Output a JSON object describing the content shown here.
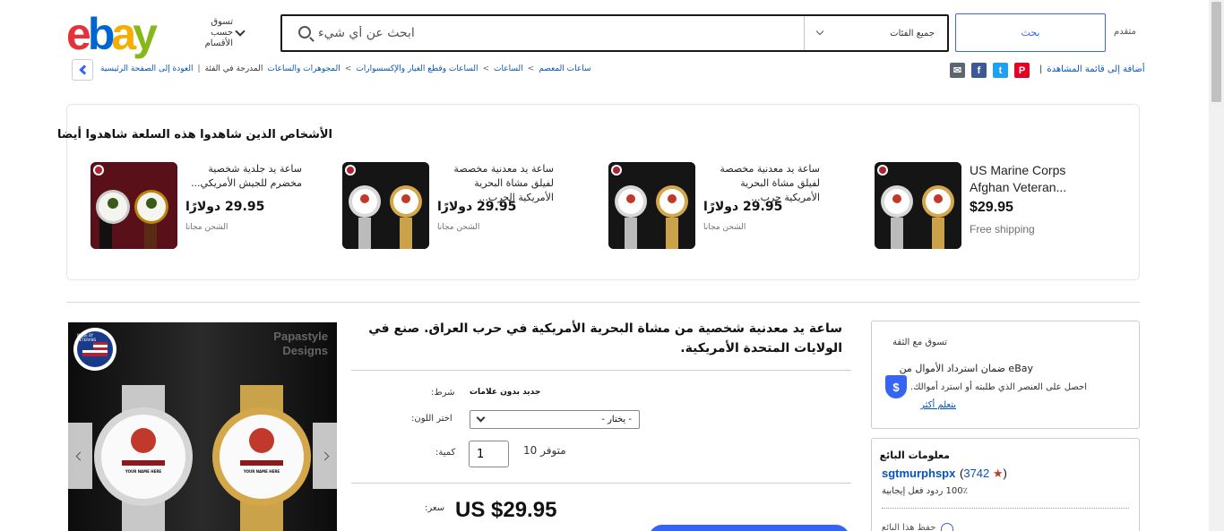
{
  "header": {
    "logo_letters": [
      "e",
      "b",
      "a",
      "y"
    ],
    "shop_by_category": "تسوق حسب الأقسام",
    "search_placeholder": "ابحث عن أي شيء",
    "category_select": "جميع الفئات",
    "search_button": "بحث",
    "advanced": "متقدم"
  },
  "nav": {
    "breadcrumbs": [
      "العودة إلى الصفحة الرئيسية",
      "|",
      "المدرجة في الفئة",
      "المجوهرات والساعات",
      "<",
      "الساعات وقطع الغيار والإكسسوارات",
      "<",
      "الساعات",
      "<",
      "ساعات المعصم"
    ],
    "add_to_watchlist": "أضافة إلى قائمة المشاهدة",
    "share_icons": [
      "email-icon",
      "facebook-icon",
      "twitter-icon",
      "pinterest-icon"
    ],
    "share_colors": [
      "#5b6670",
      "#3b5998",
      "#1da1f2",
      "#e60023"
    ]
  },
  "also_viewed": {
    "title": "الأشخاص الذين شاهدوا هذه السلعة شاهدوا أيضا",
    "items": [
      {
        "title": "ساعة يد جلدية شخصية مخضرم للجيش الأمريكي...",
        "price": "29.95 دولارًا",
        "shipping": "الشحن مجانا"
      },
      {
        "title": "ساعة يد معدنية مخصصة لفيلق مشاة البحرية الأمريكية الحرب...",
        "price": "29.95 دولارًا",
        "shipping": "الشحن مجانا"
      },
      {
        "title": "ساعة يد معدنية مخصصة لفيلق مشاة البحرية الأمريكية حرب...",
        "price": "29.95 دولارًا",
        "shipping": "الشحن مجانا"
      },
      {
        "title": "US Marine Corps Afghan Veteran...",
        "price": "$29.95",
        "shipping": "Free shipping"
      }
    ]
  },
  "product": {
    "title": "ساعة يد معدنية شخصية من مشاة البحرية الأمريكية في حرب العراق. صنع في الولايات المتحدة الأمريكية.",
    "image_brand": "Papastyle Designs",
    "image_badge": "MADE BY VETERANS",
    "dial_text": "YOUR NAME HERE",
    "condition_label": "شرط:",
    "condition_value": "جديد بدون علامات",
    "color_label": "اختر اللون:",
    "color_value": "- يختار -",
    "quantity_label": "كمية:",
    "quantity_value": "1",
    "available": "متوفر 10",
    "price_label": "سعر:",
    "price": "US $29.95"
  },
  "trust": {
    "title": "تسوق مع الثقة",
    "headline": "eBay ضمان استرداد الأموال من",
    "description": "احصل على العنصر الذي طلبته أو استرد أموالك.",
    "learn_more": "يتعلم أكثر"
  },
  "seller": {
    "title": "معلومات البائع",
    "name": "sgtmurphspx",
    "score": "3742",
    "feedback": "100٪ ردود فعل إيجابية",
    "save": "حفظ هذا البائع"
  }
}
